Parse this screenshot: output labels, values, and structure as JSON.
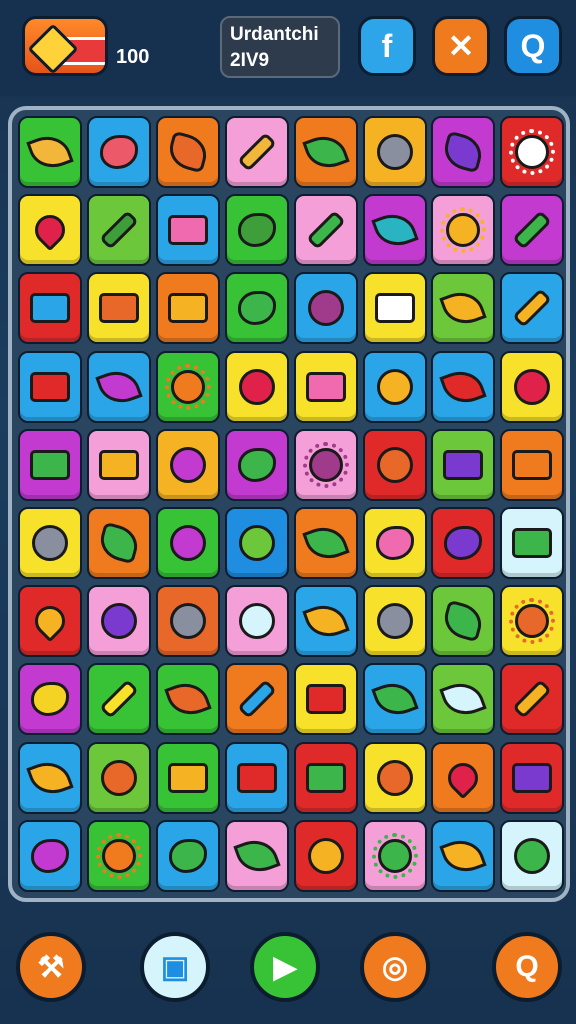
{
  "header": {
    "score": "100",
    "title_line1": "Urdantchi",
    "title_line2": "2IV9"
  },
  "top_buttons": [
    {
      "name": "share-button",
      "icon": "share-icon",
      "glyph": "f",
      "color": "#2da5e8"
    },
    {
      "name": "tools-button",
      "icon": "tools-icon",
      "glyph": "✕",
      "color": "#f07a1e"
    },
    {
      "name": "search-button",
      "icon": "search-icon",
      "glyph": "Q",
      "color": "#1f8ee0"
    }
  ],
  "grid": {
    "rows": 10,
    "cols": 8,
    "tiles": [
      {
        "color": "#38c236",
        "icon": "leaf-icon",
        "glyph": "#f2b63a",
        "shape": "leaf"
      },
      {
        "color": "#2aa6e8",
        "icon": "heart-icon",
        "glyph": "#ec5a6a",
        "shape": "blob"
      },
      {
        "color": "#f07a1e",
        "icon": "hand-icon",
        "glyph": "#e8682a",
        "shape": "star"
      },
      {
        "color": "#f59fd8",
        "icon": "cross-icon",
        "glyph": "#f2b63a",
        "shape": "cross"
      },
      {
        "color": "#f07a1e",
        "icon": "leaf-icon",
        "glyph": "#3cb54a",
        "shape": "leaf"
      },
      {
        "color": "#f5b324",
        "icon": "spiral-icon",
        "glyph": "#8a8fa0",
        "shape": "circle"
      },
      {
        "color": "#c23ad0",
        "icon": "star-icon",
        "glyph": "#7a3ad0",
        "shape": "star"
      },
      {
        "color": "#e02a2a",
        "icon": "gear-icon",
        "glyph": "#ffffff",
        "shape": "gear"
      },
      {
        "color": "#f7e12a",
        "icon": "heart-icon",
        "glyph": "#e0224a",
        "shape": "heart"
      },
      {
        "color": "#6cc83a",
        "icon": "paintbrush-icon",
        "glyph": "#3e9e3a",
        "shape": "cross"
      },
      {
        "color": "#2aa6e8",
        "icon": "eraser-icon",
        "glyph": "#f06ab0",
        "shape": "rect"
      },
      {
        "color": "#38c236",
        "icon": "snake-icon",
        "glyph": "#3e9e3a",
        "shape": "blob"
      },
      {
        "color": "#f59fd8",
        "icon": "scissors-icon",
        "glyph": "#3cb54a",
        "shape": "cross"
      },
      {
        "color": "#c23ad0",
        "icon": "feather-icon",
        "glyph": "#2ab3c0",
        "shape": "leaf"
      },
      {
        "color": "#f59fd8",
        "icon": "sun-icon",
        "glyph": "#f5b324",
        "shape": "gear"
      },
      {
        "color": "#c23ad0",
        "icon": "sword-icon",
        "glyph": "#3cb54a",
        "shape": "cross"
      },
      {
        "color": "#e02a2a",
        "icon": "envelope-icon",
        "glyph": "#2aa6e8",
        "shape": "rect"
      },
      {
        "color": "#f7e12a",
        "icon": "card-icon",
        "glyph": "#e8682a",
        "shape": "rect"
      },
      {
        "color": "#f07a1e",
        "icon": "totem-icon",
        "glyph": "#f5b324",
        "shape": "rect"
      },
      {
        "color": "#38c236",
        "icon": "dragon-icon",
        "glyph": "#3cb54a",
        "shape": "blob"
      },
      {
        "color": "#2aa6e8",
        "icon": "onion-icon",
        "glyph": "#a03a8a",
        "shape": "circle"
      },
      {
        "color": "#f7e12a",
        "icon": "totem-icon",
        "glyph": "#ffffff",
        "shape": "rect"
      },
      {
        "color": "#6cc83a",
        "icon": "horn-icon",
        "glyph": "#f5b324",
        "shape": "leaf"
      },
      {
        "color": "#2aa6e8",
        "icon": "hammer-icon",
        "glyph": "#f5b324",
        "shape": "cross"
      },
      {
        "color": "#2aa6e8",
        "icon": "flag-icon",
        "glyph": "#e02a2a",
        "shape": "rect"
      },
      {
        "color": "#2aa6e8",
        "icon": "brush-icon",
        "glyph": "#c23ad0",
        "shape": "leaf"
      },
      {
        "color": "#38c236",
        "icon": "sun-icon",
        "glyph": "#f07a1e",
        "shape": "gear"
      },
      {
        "color": "#f7e12a",
        "icon": "ring-icon",
        "glyph": "#e0224a",
        "shape": "circle"
      },
      {
        "color": "#f7e12a",
        "icon": "envelope-icon",
        "glyph": "#f06ab0",
        "shape": "rect"
      },
      {
        "color": "#2aa6e8",
        "icon": "lightbulb-icon",
        "glyph": "#f5b324",
        "shape": "circle"
      },
      {
        "color": "#2aa6e8",
        "icon": "arrow-icon",
        "glyph": "#e02a2a",
        "shape": "leaf"
      },
      {
        "color": "#f7e12a",
        "icon": "balloon-icon",
        "glyph": "#e0224a",
        "shape": "circle"
      },
      {
        "color": "#c23ad0",
        "icon": "battery-icon",
        "glyph": "#3cb54a",
        "shape": "rect"
      },
      {
        "color": "#f59fd8",
        "icon": "cup-icon",
        "glyph": "#f5b324",
        "shape": "rect"
      },
      {
        "color": "#f5b324",
        "icon": "spiral-icon",
        "glyph": "#c23ad0",
        "shape": "circle"
      },
      {
        "color": "#c23ad0",
        "icon": "fish-icon",
        "glyph": "#3cb54a",
        "shape": "blob"
      },
      {
        "color": "#f59fd8",
        "icon": "gear-icon",
        "glyph": "#a03a8a",
        "shape": "gear"
      },
      {
        "color": "#e02a2a",
        "icon": "pepper-icon",
        "glyph": "#e8682a",
        "shape": "circle"
      },
      {
        "color": "#6cc83a",
        "icon": "box-icon",
        "glyph": "#7a3ad0",
        "shape": "rect"
      },
      {
        "color": "#f07a1e",
        "icon": "totem-icon",
        "glyph": "#f07a1e",
        "shape": "rect"
      },
      {
        "color": "#f7e12a",
        "icon": "gear-icon",
        "glyph": "#8a8fa0",
        "shape": "circle"
      },
      {
        "color": "#f07a1e",
        "icon": "plant-icon",
        "glyph": "#3cb54a",
        "shape": "star"
      },
      {
        "color": "#38c236",
        "icon": "trophy-icon",
        "glyph": "#c23ad0",
        "shape": "circle"
      },
      {
        "color": "#1f8ee0",
        "icon": "ring-icon",
        "glyph": "#6cc83a",
        "shape": "circle"
      },
      {
        "color": "#f07a1e",
        "icon": "horn-icon",
        "glyph": "#3cb54a",
        "shape": "leaf"
      },
      {
        "color": "#f7e12a",
        "icon": "bean-icon",
        "glyph": "#f06ab0",
        "shape": "blob"
      },
      {
        "color": "#e02a2a",
        "icon": "speech-bubble-icon",
        "glyph": "#7a3ad0",
        "shape": "blob"
      },
      {
        "color": "#d6f4fb",
        "icon": "battery-icon",
        "glyph": "#3cb54a",
        "shape": "rect"
      },
      {
        "color": "#e02a2a",
        "icon": "apple-icon",
        "glyph": "#f5b324",
        "shape": "heart"
      },
      {
        "color": "#f59fd8",
        "icon": "plum-icon",
        "glyph": "#7a3ad0",
        "shape": "circle"
      },
      {
        "color": "#e8682a",
        "icon": "spiral-icon",
        "glyph": "#8a8fa0",
        "shape": "circle"
      },
      {
        "color": "#f59fd8",
        "icon": "swirl-icon",
        "glyph": "#d6f4fb",
        "shape": "circle"
      },
      {
        "color": "#2aa6e8",
        "icon": "leaf-icon",
        "glyph": "#f5b324",
        "shape": "leaf"
      },
      {
        "color": "#f7e12a",
        "icon": "gear-icon",
        "glyph": "#8a8fa0",
        "shape": "circle"
      },
      {
        "color": "#6cc83a",
        "icon": "sprout-icon",
        "glyph": "#3cb54a",
        "shape": "star"
      },
      {
        "color": "#f7e12a",
        "icon": "sun-icon",
        "glyph": "#e8682a",
        "shape": "gear"
      },
      {
        "color": "#c23ad0",
        "icon": "face-icon",
        "glyph": "#f5d324",
        "shape": "blob"
      },
      {
        "color": "#38c236",
        "icon": "cross-icon",
        "glyph": "#f7e12a",
        "shape": "cross"
      },
      {
        "color": "#38c236",
        "icon": "seed-icon",
        "glyph": "#e8682a",
        "shape": "leaf"
      },
      {
        "color": "#f07a1e",
        "icon": "starfish-icon",
        "glyph": "#2aa6e8",
        "shape": "cross"
      },
      {
        "color": "#f7e12a",
        "icon": "brush-icon",
        "glyph": "#e02a2a",
        "shape": "rect"
      },
      {
        "color": "#2aa6e8",
        "icon": "leaf-icon",
        "glyph": "#3cb54a",
        "shape": "leaf"
      },
      {
        "color": "#6cc83a",
        "icon": "feather-icon",
        "glyph": "#d6f4fb",
        "shape": "leaf"
      },
      {
        "color": "#e02a2a",
        "icon": "cross-icon",
        "glyph": "#f5b324",
        "shape": "cross"
      },
      {
        "color": "#2aa6e8",
        "icon": "leaf-icon",
        "glyph": "#f5b324",
        "shape": "leaf"
      },
      {
        "color": "#6cc83a",
        "icon": "snail-icon",
        "glyph": "#e8682a",
        "shape": "circle"
      },
      {
        "color": "#38c236",
        "icon": "totem-icon",
        "glyph": "#f5b324",
        "shape": "rect"
      },
      {
        "color": "#2aa6e8",
        "icon": "pen-icon",
        "glyph": "#e02a2a",
        "shape": "rect"
      },
      {
        "color": "#e02a2a",
        "icon": "picture-icon",
        "glyph": "#3cb54a",
        "shape": "rect"
      },
      {
        "color": "#f7e12a",
        "icon": "egg-icon",
        "glyph": "#e8682a",
        "shape": "circle"
      },
      {
        "color": "#f07a1e",
        "icon": "heart-icon",
        "glyph": "#e0224a",
        "shape": "heart"
      },
      {
        "color": "#e02a2a",
        "icon": "crayon-icon",
        "glyph": "#7a3ad0",
        "shape": "rect"
      },
      {
        "color": "#2aa6e8",
        "icon": "hat-icon",
        "glyph": "#c23ad0",
        "shape": "blob"
      },
      {
        "color": "#38c236",
        "icon": "sun-icon",
        "glyph": "#f07a1e",
        "shape": "gear"
      },
      {
        "color": "#2aa6e8",
        "icon": "dragon-icon",
        "glyph": "#3cb54a",
        "shape": "blob"
      },
      {
        "color": "#f59fd8",
        "icon": "leaf-icon",
        "glyph": "#3cb54a",
        "shape": "leaf"
      },
      {
        "color": "#e02a2a",
        "icon": "smiley-icon",
        "glyph": "#f5b324",
        "shape": "circle"
      },
      {
        "color": "#f59fd8",
        "icon": "gear-icon",
        "glyph": "#3cb54a",
        "shape": "gear"
      },
      {
        "color": "#2aa6e8",
        "icon": "leaf-icon",
        "glyph": "#f5b324",
        "shape": "leaf"
      },
      {
        "color": "#d6f4fb",
        "icon": "globe-icon",
        "glyph": "#3cb54a",
        "shape": "circle"
      }
    ]
  },
  "bottom_buttons": [
    {
      "name": "hammer-button",
      "icon": "hammer-icon",
      "glyph": "⚒",
      "color": "#f07a1e"
    },
    {
      "name": "frame-button",
      "icon": "frame-icon",
      "glyph": "▣",
      "color": "#d6f4fb"
    },
    {
      "name": "play-button",
      "icon": "play-icon",
      "glyph": "▶",
      "color": "#38c236"
    },
    {
      "name": "target-button",
      "icon": "target-icon",
      "glyph": "◎",
      "color": "#f07a1e"
    },
    {
      "name": "hint-button",
      "icon": "magnifier-icon",
      "glyph": "Q",
      "color": "#f07a1e"
    }
  ]
}
